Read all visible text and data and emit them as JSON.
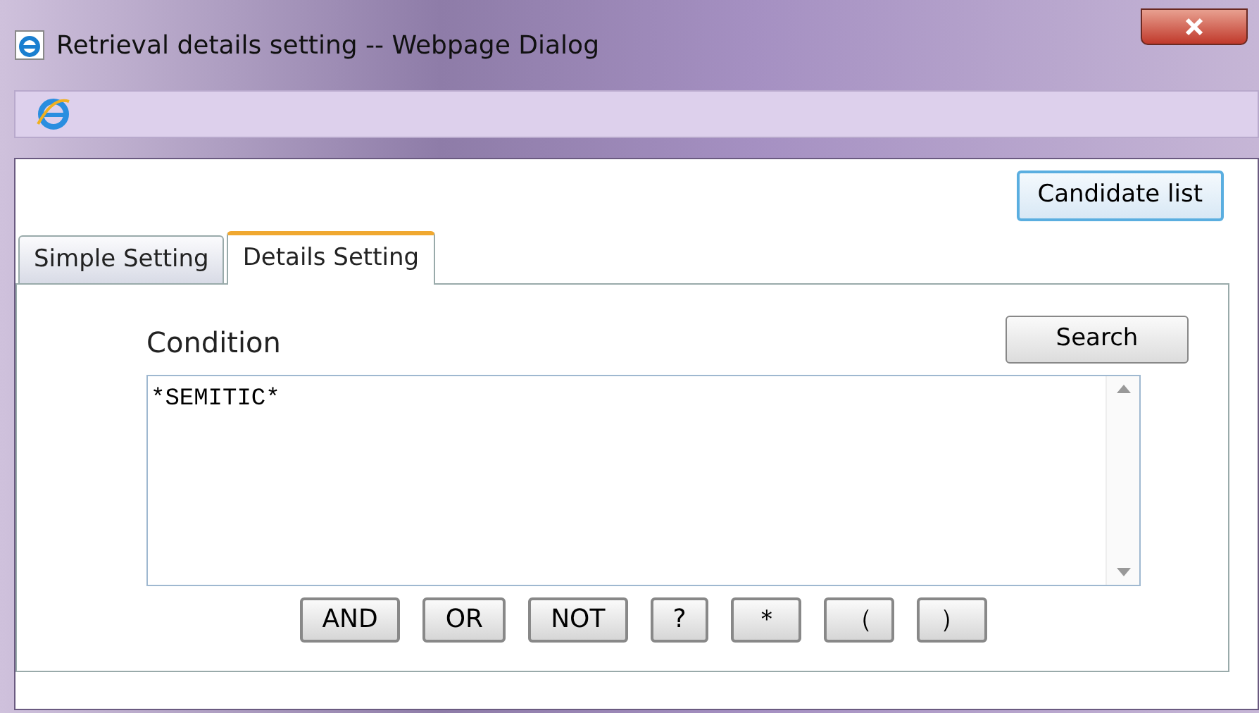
{
  "window": {
    "title": "Retrieval details setting -- Webpage Dialog"
  },
  "candidate_button": "Candidate list",
  "tabs": [
    {
      "label": "Simple Setting",
      "selected": false
    },
    {
      "label": "Details Setting",
      "selected": true
    }
  ],
  "condition": {
    "label": "Condition",
    "value": "*SEMITIC*"
  },
  "search_button": "Search",
  "operators": [
    "AND",
    "OR",
    "NOT",
    "?",
    "＊",
    "（",
    "）"
  ]
}
